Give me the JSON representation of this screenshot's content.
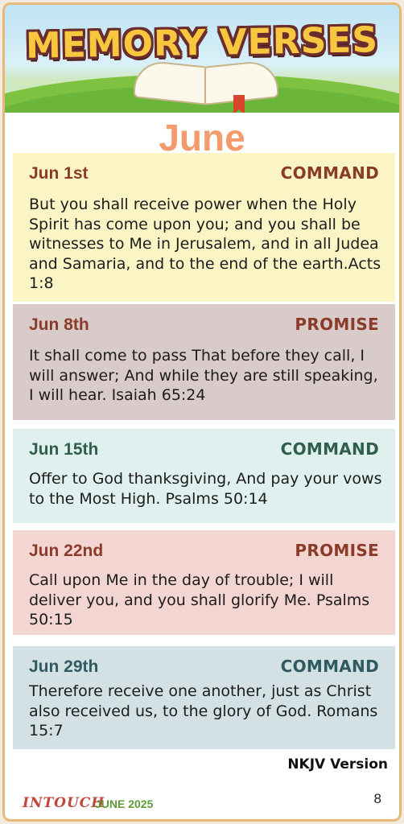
{
  "header": {
    "title": "MEMORY VERSES"
  },
  "month": "June",
  "verses": [
    {
      "date": "Jun 1st",
      "kind": "COMMAND",
      "text": "But you shall receive power when the Holy Spirit has come upon you; and you shall be witnesses to Me in Jerusalem, and in all Judea and Samaria, and to the end of the earth.Acts 1:8"
    },
    {
      "date": "Jun 8th",
      "kind": "PROMISE",
      "text": "It shall come to pass That before they call, I will answer; And while they are still speaking, I will hear. Isaiah 65:24"
    },
    {
      "date": "Jun 15th",
      "kind": "COMMAND",
      "text": "Offer to God thanksgiving, And pay your vows to the Most High. Psalms 50:14"
    },
    {
      "date": "Jun 22nd",
      "kind": "PROMISE",
      "text": "Call upon Me in the day of trouble; I will deliver you, and you shall glorify Me. Psalms 50:15"
    },
    {
      "date": "Jun 29th",
      "kind": "COMMAND",
      "text": "Therefore receive one another, just as Christ also received us, to the glory of God. Romans 15:7"
    }
  ],
  "version": "NKJV Version",
  "footer": {
    "brand": "INTOUCH",
    "issue": "JUNE 2025",
    "page": "8"
  },
  "colors": {
    "border": "#e8b87a",
    "month": "#f39b6d",
    "command_dark": "#8a3b2a",
    "command_teal": "#2f5f4a"
  }
}
